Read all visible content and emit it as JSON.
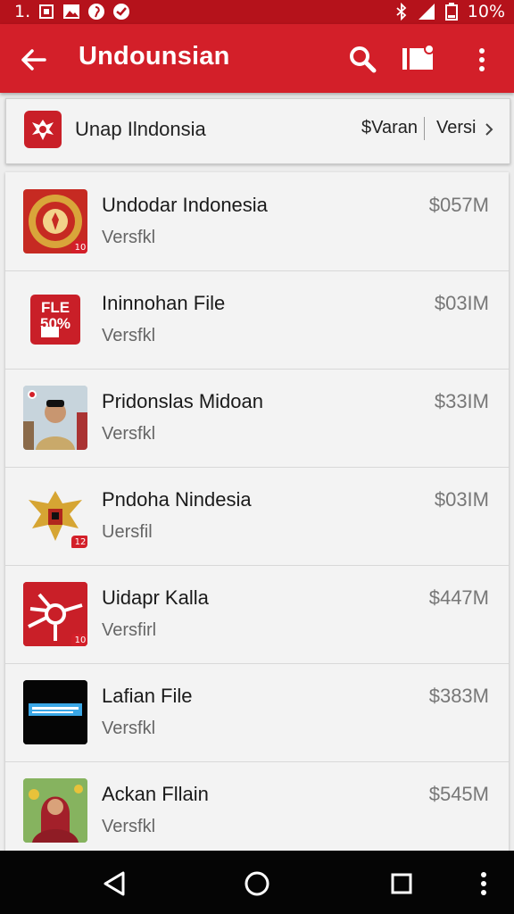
{
  "status_bar": {
    "left_text": "1.",
    "battery": "10%",
    "icons": [
      "sim-icon",
      "image-icon",
      "pinterest-icon",
      "vpn-icon",
      "bluetooth-icon",
      "signal-icon",
      "battery-icon"
    ]
  },
  "app_bar": {
    "title": "Undounsian",
    "icons": [
      "back-arrow-icon",
      "search-icon",
      "tag-icon",
      "more-vert-icon"
    ]
  },
  "filter": {
    "label": "Unap Ilndonsia",
    "option1": "$Varan",
    "option2": "Versi"
  },
  "items": [
    {
      "title": "Undodar Indonesia",
      "subtitle": "Versfkl",
      "size": "$057M",
      "thumb": "emblem-seal",
      "badge": "10"
    },
    {
      "title": "Ininnohan File",
      "subtitle": "Versfkl",
      "size": "$03IM",
      "thumb": "file-sale",
      "thumb_text": [
        "FLE",
        "50%"
      ]
    },
    {
      "title": "Pridonslas Midoan",
      "subtitle": "Versfkl",
      "size": "$33IM",
      "thumb": "man-photo"
    },
    {
      "title": "Pndoha Nindesia",
      "subtitle": "Uersfil",
      "size": "$03IM",
      "thumb": "garuda-emblem",
      "badge": "12"
    },
    {
      "title": "Uidapr Kalla",
      "subtitle": "Versfirl",
      "size": "$447M",
      "thumb": "sun-symbol",
      "badge": "10"
    },
    {
      "title": "Lafian File",
      "subtitle": "Versfkl",
      "size": "$383M",
      "thumb": "dark-banner"
    },
    {
      "title": "Ackan Fllain",
      "subtitle": "Versfkl",
      "size": "$545M",
      "thumb": "woman-photo"
    }
  ],
  "nav_bar": {
    "icons": [
      "back-triangle-icon",
      "home-circle-icon",
      "recents-square-icon",
      "more-dots-icon"
    ]
  },
  "colors": {
    "primary": "#d31f29",
    "status_bar": "#b5121b",
    "background": "#ededed",
    "nav_bar": "#050505"
  }
}
